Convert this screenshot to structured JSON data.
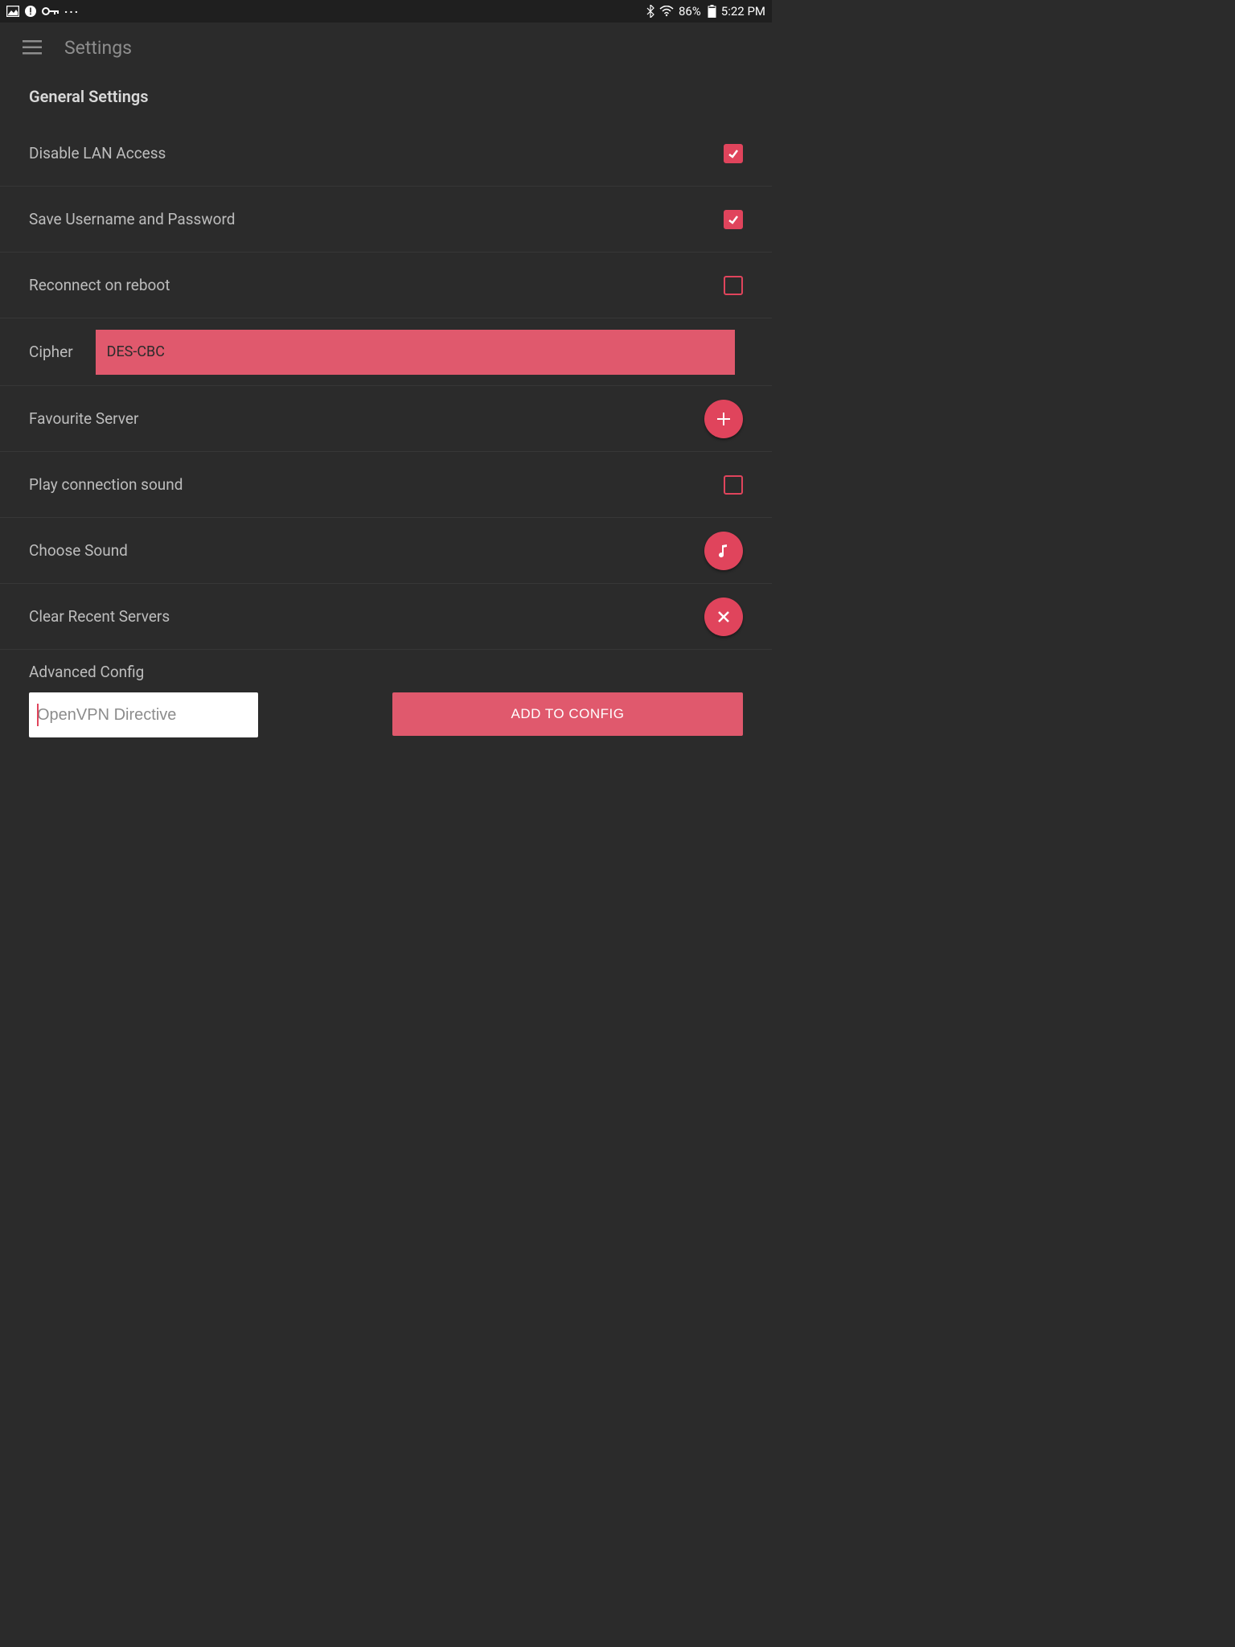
{
  "status_bar": {
    "battery_pct": "86%",
    "time": "5:22 PM"
  },
  "app_bar": {
    "title": "Settings"
  },
  "section_title": "General Settings",
  "rows": {
    "disable_lan": {
      "label": "Disable LAN Access",
      "checked": true
    },
    "save_creds": {
      "label": "Save Username and Password",
      "checked": true
    },
    "reconnect_reboot": {
      "label": "Reconnect on reboot",
      "checked": false
    },
    "cipher": {
      "label": "Cipher",
      "value": "DES-CBC"
    },
    "fav_server": {
      "label": "Favourite Server"
    },
    "play_sound": {
      "label": "Play connection sound",
      "checked": false
    },
    "choose_sound": {
      "label": "Choose Sound"
    },
    "clear_recent": {
      "label": "Clear Recent Servers"
    }
  },
  "advanced": {
    "label": "Advanced Config",
    "placeholder": "OpenVPN Directive",
    "button": "ADD TO CONFIG"
  },
  "colors": {
    "accent": "#e0445c",
    "accent_light": "#e0596d",
    "bg": "#2b2b2b"
  }
}
